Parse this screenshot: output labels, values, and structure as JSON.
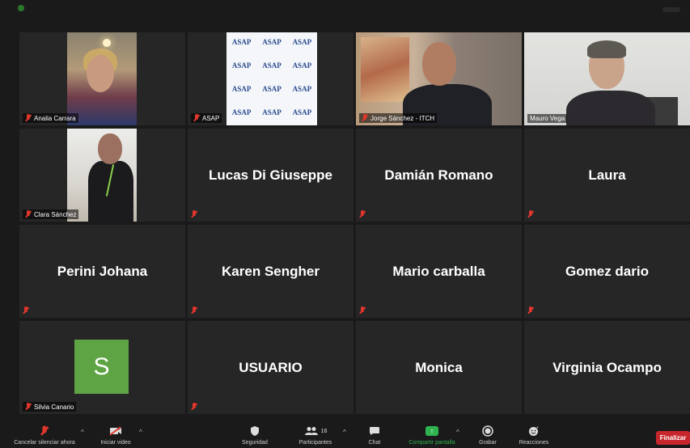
{
  "participants": [
    {
      "id": "analia",
      "display_label": "Analia Carrara"
    },
    {
      "id": "asap",
      "display_label": "ASAP",
      "screen_text": "ASAP"
    },
    {
      "id": "jorge",
      "display_label": "Jorge Sánchez - ITCH"
    },
    {
      "id": "mauro",
      "display_label": "Mauro Vega"
    },
    {
      "id": "clara",
      "display_label": "Clara Sánchez"
    },
    {
      "id": "lucas",
      "big_name": "Lucas Di Giuseppe"
    },
    {
      "id": "damian",
      "big_name": "Damián Romano"
    },
    {
      "id": "laura",
      "big_name": "Laura"
    },
    {
      "id": "perini",
      "big_name": "Perini Johana"
    },
    {
      "id": "karen",
      "big_name": "Karen Sengher"
    },
    {
      "id": "mario",
      "big_name": "Mario carballa"
    },
    {
      "id": "gomez",
      "big_name": "Gomez dario"
    },
    {
      "id": "silvia",
      "display_label": "Silvia Canario",
      "avatar_letter": "S"
    },
    {
      "id": "usuario",
      "big_name": "USUARIO"
    },
    {
      "id": "monica",
      "big_name": "Monica"
    },
    {
      "id": "virginia",
      "big_name": "Virginia Ocampo"
    }
  ],
  "toolbar": {
    "unmute_label": "Cancelar silenciar ahora",
    "video_label": "Iniciar video",
    "security_label": "Seguridad",
    "participants_label": "Participantes",
    "participants_count": "16",
    "chat_label": "Chat",
    "share_label": "Compartir pantalla",
    "record_label": "Grabar",
    "reactions_label": "Reacciones",
    "end_label": "Finalizar"
  },
  "colors": {
    "tile_bg": "#262626",
    "active_speaker_outline": "#d8e07a",
    "muted_red": "#e0362c",
    "share_green": "#2fb34f",
    "end_red": "#c7272c",
    "avatar_green": "#5fa444"
  },
  "icons": [
    "muted-mic-icon",
    "video-off-icon",
    "shield-icon",
    "participants-icon",
    "chat-icon",
    "share-screen-icon",
    "record-icon",
    "reactions-icon",
    "caret-up-icon"
  ]
}
